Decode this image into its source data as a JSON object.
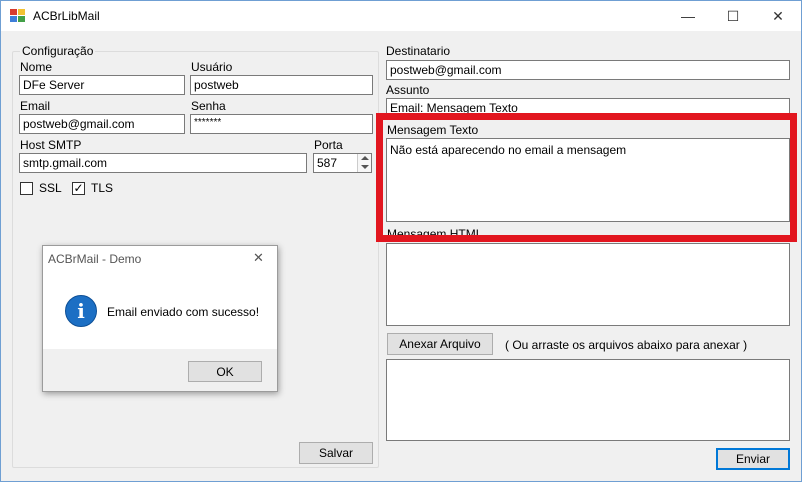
{
  "window": {
    "title": "ACBrLibMail",
    "minimize_glyph": "—",
    "maximize_glyph": "☐",
    "close_glyph": "✕",
    "icon_colors": [
      "#d83b2d",
      "#f2c233",
      "#3f7ed8",
      "#43a047"
    ]
  },
  "config": {
    "group_title": "Configuração",
    "nome_label": "Nome",
    "nome_value": "DFe Server",
    "usuario_label": "Usuário",
    "usuario_value": "postweb",
    "email_label": "Email",
    "email_value": "postweb@gmail.com",
    "senha_label": "Senha",
    "senha_value": "*******",
    "host_label": "Host SMTP",
    "host_value": "smtp.gmail.com",
    "porta_label": "Porta",
    "porta_value": "587",
    "ssl_label": "SSL",
    "ssl_checked": false,
    "tls_label": "TLS",
    "tls_checked": true,
    "check_glyph": "✓",
    "salvar_label": "Salvar"
  },
  "message": {
    "destinatario_label": "Destinatario",
    "destinatario_value": "postweb@gmail.com",
    "assunto_label": "Assunto",
    "assunto_value": "Email: Mensagem Texto",
    "texto_label": "Mensagem Texto",
    "texto_value": "Não está aparecendo no email a mensagem",
    "html_label": "Mensagem HTML",
    "anexar_label": "Anexar Arquivo",
    "anexar_hint": "( Ou arraste os arquivos abaixo para anexar )",
    "enviar_label": "Enviar"
  },
  "dialog": {
    "title": "ACBrMail - Demo",
    "close_glyph": "✕",
    "message": "Email enviado com sucesso!",
    "icon_glyph": "i",
    "ok_label": "OK"
  },
  "annotation": {
    "highlight_color": "#e2161f"
  }
}
